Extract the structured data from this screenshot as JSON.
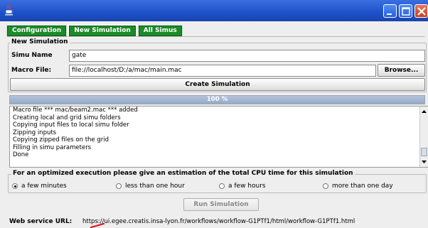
{
  "window": {
    "icon": "java-cup-icon",
    "controls": [
      "minimize",
      "maximize",
      "close"
    ]
  },
  "tabs": [
    {
      "label": "Configuration",
      "active": false
    },
    {
      "label": "New Simulation",
      "active": true
    },
    {
      "label": "All Simus",
      "active": false
    }
  ],
  "new_simulation": {
    "legend": "New Simulation",
    "simu_name_label": "Simu Name",
    "simu_name_value": "gate",
    "macro_file_label": "Macro File:",
    "macro_file_value": "file://localhost/D:/a/mac/main.mac",
    "browse_label": "Browse...",
    "create_label": "Create Simulation"
  },
  "progress": {
    "text": "100 %",
    "value": 100
  },
  "log": {
    "lines": [
      "Macro file *** mac/beam2.mac *** added",
      "Creating local and grid simu folders",
      "Copying input files to local simu folder",
      "Zipping inputs",
      "Copying zipped files on the grid",
      "Filling in simu parameters",
      "Done"
    ]
  },
  "cpu": {
    "legend": "For an optimized execution please give an estimation of the total CPU time for this simulation",
    "options": [
      {
        "label": "a few minutes",
        "checked": true
      },
      {
        "label": "less than one hour",
        "checked": false
      },
      {
        "label": "a few hours",
        "checked": false
      },
      {
        "label": "more than one day",
        "checked": false
      }
    ]
  },
  "run_label": "Run Simulation",
  "web_service": {
    "label": "Web service URL:",
    "url": "https://ui.egee.creatis.insa-lyon.fr/workflows/workflow-G1PTf1/html/workflow-G1PTf1.html"
  },
  "colors": {
    "tab_green": "#1c8a2a",
    "title_blue": "#2a5fd8",
    "close_red": "#d4532e"
  }
}
